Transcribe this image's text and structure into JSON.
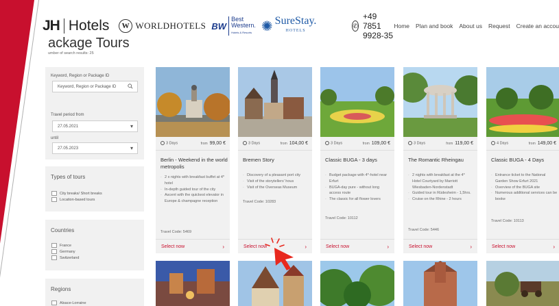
{
  "header": {
    "logo_main_left": "JH",
    "logo_main_right": "Hotels",
    "logo_ww_letter": "W",
    "logo_ww_text": "WORLDHOTELS",
    "logo_bw_mark": "BW",
    "logo_bw_text1": "Best Western.",
    "logo_bw_text2": "Hotels & Resorts",
    "logo_ss_text": "SureStay.",
    "logo_ss_sub": "HOTELS",
    "phone": "+49 7851 9928-35",
    "nav": [
      "Home",
      "Plan and book",
      "About us",
      "Request",
      "Create an accou"
    ]
  },
  "page": {
    "title": "ackage Tours",
    "results": "umber of search results: 25"
  },
  "filter": {
    "keyword_label": "Keyword, Region or Package ID",
    "keyword_placeholder": "Keyword, Region or Package ID",
    "period_from_label": "Travel period from",
    "period_from_value": "27.05.2021",
    "until_label": "until",
    "until_value": "27.05.2023",
    "types_heading": "Types of tours",
    "types": [
      "City breaks/ Short breaks",
      "Location-based tours"
    ],
    "countries_heading": "Countries",
    "countries": [
      "France",
      "Germany",
      "Switzerland"
    ],
    "regions_heading": "Regions",
    "regions": [
      "Alsace-Lorraine"
    ]
  },
  "cards": [
    {
      "days": "3 Days",
      "from": "from",
      "price": "99,00 €",
      "title": "Berlin - Weekend in the world metropolis",
      "bullets": [
        "2 x nights with breakfast buffet at 4* hotel",
        "In-depth guided tour of the city",
        "Ascent with the quickest elevator in Europe & champagne reception"
      ],
      "code": "Travel Code: 5469",
      "select": "Select now"
    },
    {
      "days": "3 Days",
      "from": "from",
      "price": "104,00 €",
      "title": "Bremen Story",
      "bullets": [
        "Discovery of a pleasant port city",
        "Visit of the storytellers' hous",
        "Visit of the Overseas Museum"
      ],
      "code": "Travel Code: 10283",
      "select": "Select now"
    },
    {
      "days": "3 Days",
      "from": "from",
      "price": "109,00 €",
      "title": "Classic BUGA - 3 days",
      "bullets": [
        "Budget package with 4*-hotel near Erfurt",
        "BUGA-day pure - without long access route",
        "The classic for all flower lovers"
      ],
      "code": "Travel Code: 10112",
      "select": "Select now"
    },
    {
      "days": "3 Days",
      "from": "from",
      "price": "119,00 €",
      "title": "The Romantic Rheingau",
      "bullets": [
        "2 nights with breakfast at the 4* Hotel Courtyard by Marriott Wiesbaden-Nordenstadt",
        "Guided tour in Rüdesheim - 1,5hrs.",
        "Cruise on the Rhine - 2 hours"
      ],
      "code": "Travel Code: 5446",
      "select": "Select now"
    },
    {
      "days": "4 Days",
      "from": "from",
      "price": "149,00 €",
      "title": "Classic BUGA - 4 Days",
      "bullets": [
        "Entrance ticket to the National Garden Show Erfurt 2021",
        "Overview of the BUGA site",
        "Numerous additional services can be booke"
      ],
      "code": "Travel Code: 10113",
      "select": "Select now"
    }
  ],
  "colors": {
    "accent": "#c8102e",
    "panel": "#f1f1f1"
  }
}
